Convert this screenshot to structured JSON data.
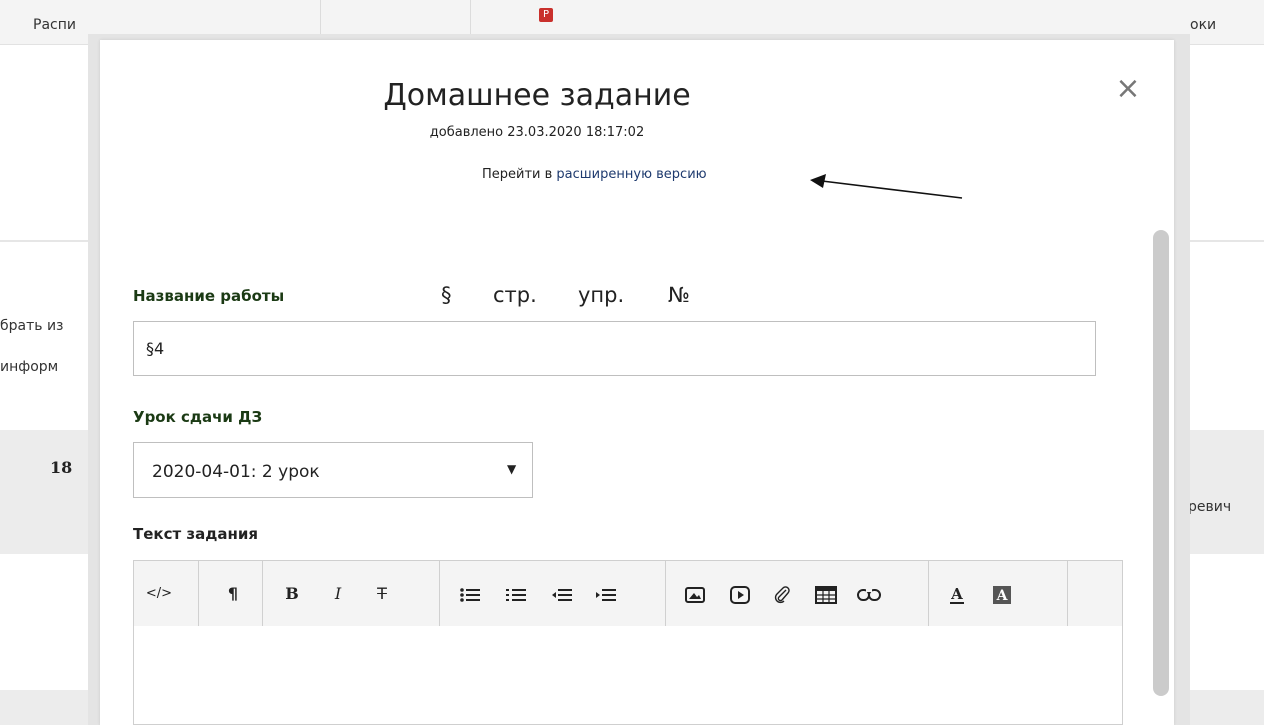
{
  "background": {
    "header_left": "Распи",
    "header_right": "оки",
    "header_badge": "Р",
    "side_text_1": "брать из",
    "side_text_2": "информ",
    "row_number": "18",
    "right_text": "ревич"
  },
  "modal": {
    "title": "Домашнее задание",
    "subtitle": "добавлено 23.03.2020 18:17:02",
    "link_prefix": "Перейти в ",
    "link_text": "расширенную версию",
    "close_symbol": "×",
    "work_name_label": "Название работы",
    "quick_buttons": [
      "§",
      "стр.",
      "упр.",
      "№"
    ],
    "work_name_value": "§4",
    "due_lesson_label": "Урок сдачи ДЗ",
    "due_lesson_value": "2020-04-01: 2 урок",
    "task_text_label": "Текст задания"
  },
  "toolbar": {
    "source_label": "</>",
    "paragraph_label": "¶",
    "bold_label": "B",
    "italic_label": "I",
    "strike_label": "T"
  },
  "colors": {
    "label_green": "#1b3a14",
    "link_blue": "#1e3a6e",
    "badge_red": "#c9302c"
  }
}
